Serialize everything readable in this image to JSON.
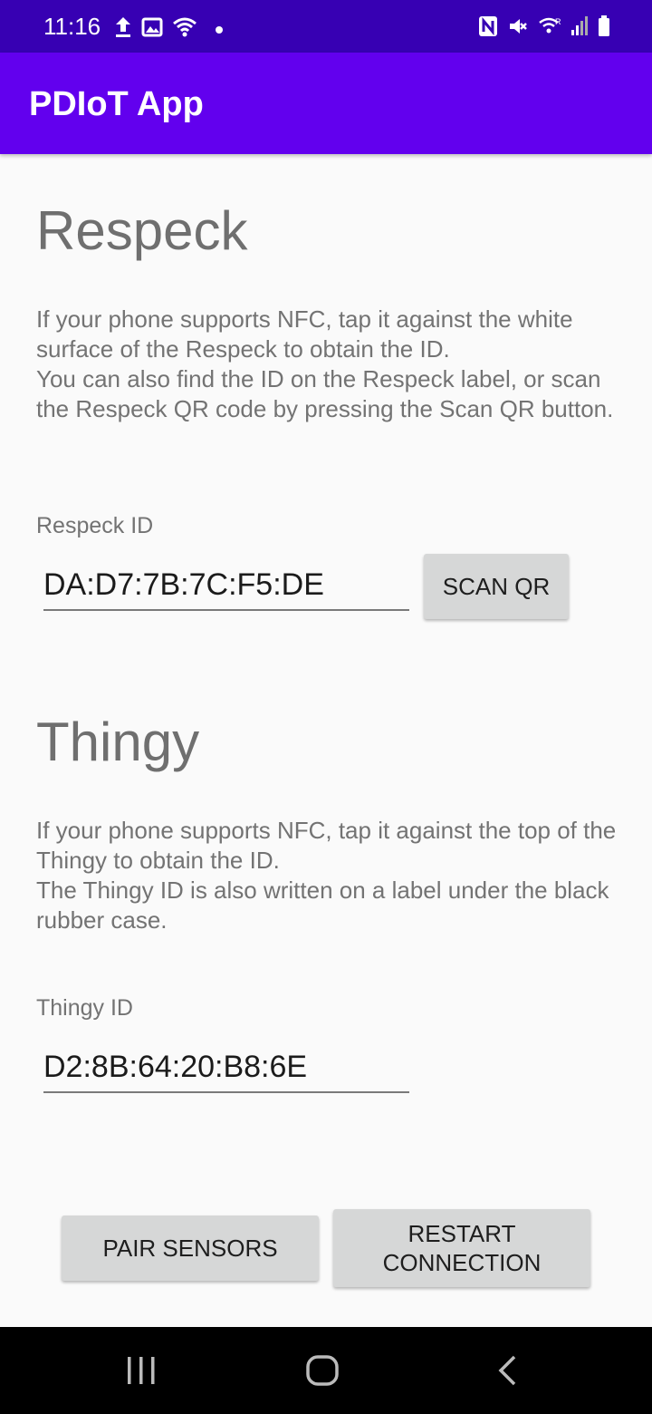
{
  "status_bar": {
    "time": "11:16",
    "left_icons": [
      "upload-icon",
      "image-icon",
      "wifi-icon",
      "dot-icon"
    ],
    "right_icons": [
      "nfc-icon",
      "mute-icon",
      "wifi-calling-icon",
      "signal-icon",
      "battery-icon"
    ]
  },
  "app_bar": {
    "title": "PDIoT App"
  },
  "respeck": {
    "title": "Respeck",
    "description": "If your phone supports NFC, tap it against the white surface of the Respeck to obtain the ID.\nYou can also find the ID on the Respeck label, or scan the Respeck QR code by pressing the Scan QR button.",
    "id_label": "Respeck ID",
    "id_value": "DA:D7:7B:7C:F5:DE",
    "scan_button": "SCAN QR"
  },
  "thingy": {
    "title": "Thingy",
    "description": "If your phone supports NFC, tap it against the top of the Thingy to obtain the ID.\nThe Thingy ID is also written on a label under the black rubber case.",
    "id_label": "Thingy ID",
    "id_value": "D2:8B:64:20:B8:6E"
  },
  "actions": {
    "pair_button": "PAIR SENSORS",
    "restart_button": "RESTART\nCONNECTION"
  },
  "nav_bar": {
    "items": [
      "recents-icon",
      "home-icon",
      "back-icon"
    ]
  },
  "colors": {
    "status_bar": "#3700b3",
    "app_bar": "#6200ee",
    "button": "#d6d7d7"
  }
}
